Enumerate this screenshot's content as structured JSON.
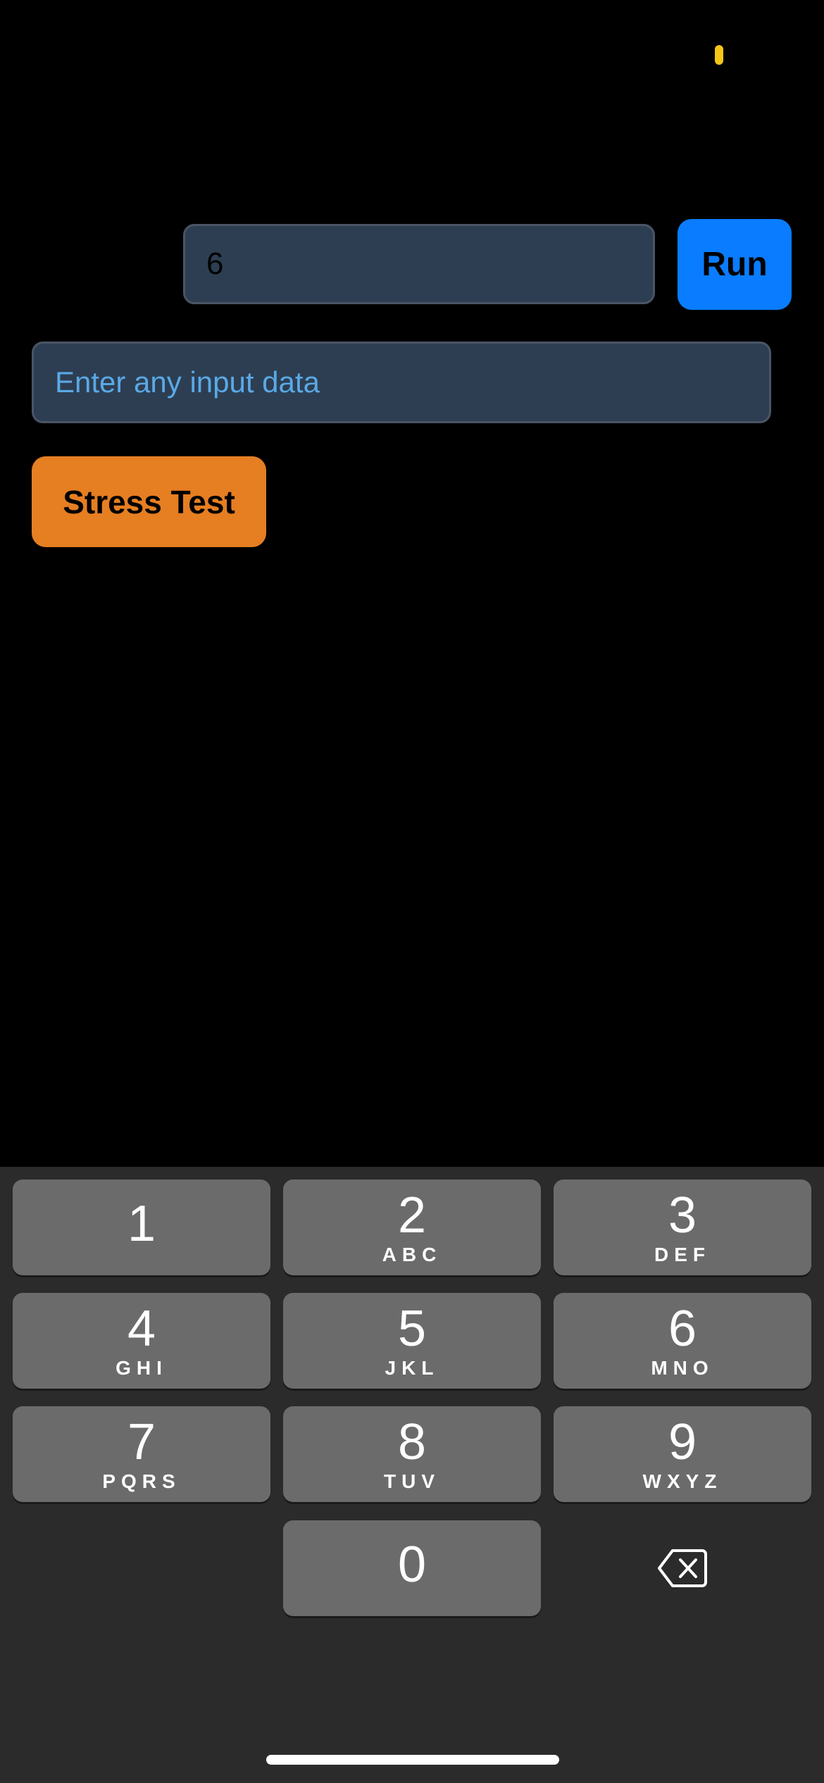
{
  "form": {
    "number_value": "6",
    "run_label": "Run",
    "data_placeholder": "Enter any input data",
    "data_value": "",
    "stress_label": "Stress Test"
  },
  "keyboard": {
    "keys": [
      {
        "digit": "1",
        "letters": ""
      },
      {
        "digit": "2",
        "letters": "ABC"
      },
      {
        "digit": "3",
        "letters": "DEF"
      },
      {
        "digit": "4",
        "letters": "GHI"
      },
      {
        "digit": "5",
        "letters": "JKL"
      },
      {
        "digit": "6",
        "letters": "MNO"
      },
      {
        "digit": "7",
        "letters": "PQRS"
      },
      {
        "digit": "8",
        "letters": "TUV"
      },
      {
        "digit": "9",
        "letters": "WXYZ"
      },
      {
        "digit": "0",
        "letters": ""
      }
    ],
    "backspace_icon": "backspace-icon"
  },
  "colors": {
    "background": "#000000",
    "input_bg": "#2d3e52",
    "run_button": "#0a7cff",
    "stress_button": "#e67e22",
    "placeholder": "#5aa9e6",
    "keyboard_bg": "#2b2b2b",
    "key_bg": "#6b6b6b",
    "status_indicator": "#f5c518"
  }
}
